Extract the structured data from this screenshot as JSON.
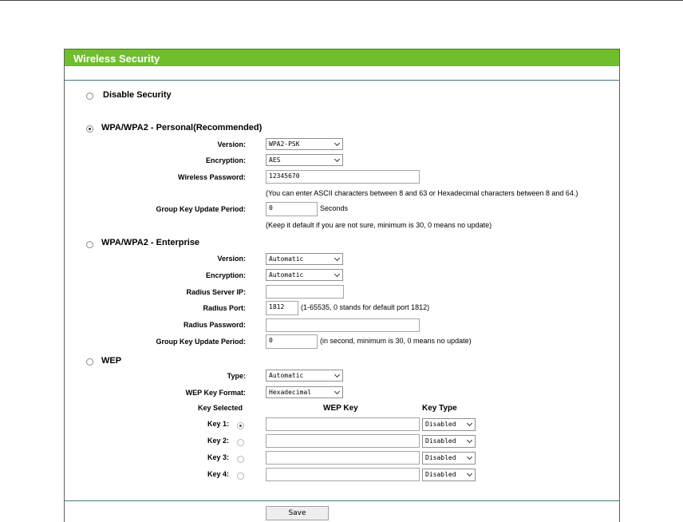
{
  "title": "Wireless Security",
  "disable": {
    "label": "Disable Security",
    "selected": false
  },
  "personal": {
    "label": "WPA/WPA2 - Personal(Recommended)",
    "selected": true,
    "version_label": "Version:",
    "version_value": "WPA2-PSK",
    "encryption_label": "Encryption:",
    "encryption_value": "AES",
    "password_label": "Wireless Password:",
    "password_value": "12345670",
    "password_note": "(You can enter ASCII characters between 8 and 63 or Hexadecimal characters between 8 and 64.)",
    "group_label": "Group Key Update Period:",
    "group_value": "0",
    "group_unit": "Seconds",
    "group_note": "(Keep it default if you are not sure, minimum is 30, 0 means no update)"
  },
  "enterprise": {
    "label": "WPA/WPA2 - Enterprise",
    "selected": false,
    "version_label": "Version:",
    "version_value": "Automatic",
    "encryption_label": "Encryption:",
    "encryption_value": "Automatic",
    "radius_ip_label": "Radius Server IP:",
    "radius_ip_value": "",
    "radius_port_label": "Radius Port:",
    "radius_port_value": "1812",
    "radius_port_note": "(1-65535, 0 stands for default port 1812)",
    "radius_password_label": "Radius Password:",
    "radius_password_value": "",
    "group_label": "Group Key Update Period:",
    "group_value": "0",
    "group_note": "(in second, minimum is 30, 0 means no update)"
  },
  "wep": {
    "label": "WEP",
    "selected": false,
    "type_label": "Type:",
    "type_value": "Automatic",
    "format_label": "WEP Key Format:",
    "format_value": "Hexadecimal",
    "key_selected_header": "Key Selected",
    "wep_key_header": "WEP Key",
    "key_type_header": "Key Type",
    "keys": [
      {
        "label": "Key 1:",
        "selected": true,
        "value": "",
        "type": "Disabled"
      },
      {
        "label": "Key 2:",
        "selected": false,
        "value": "",
        "type": "Disabled"
      },
      {
        "label": "Key 3:",
        "selected": false,
        "value": "",
        "type": "Disabled"
      },
      {
        "label": "Key 4:",
        "selected": false,
        "value": "",
        "type": "Disabled"
      }
    ]
  },
  "save_label": "Save",
  "colors": {
    "header": "#6fbf2d",
    "rule": "#3e7a8b"
  }
}
